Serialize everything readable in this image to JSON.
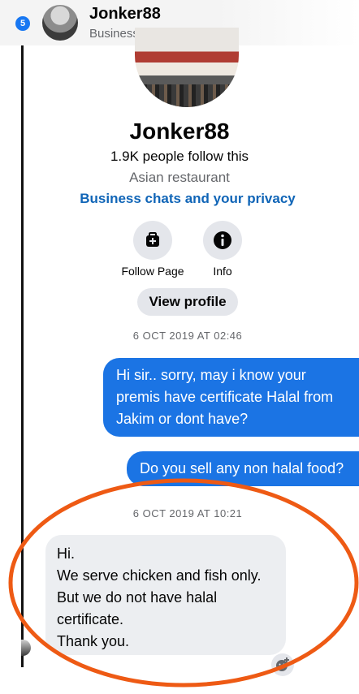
{
  "header": {
    "notif_badge": "5",
    "name": "Jonker88",
    "subtitle": "Business chat"
  },
  "profile": {
    "name": "Jonker88",
    "followers": "1.9K people follow this",
    "category": "Asian restaurant",
    "privacy_link": "Business chats and your privacy"
  },
  "actions": [
    {
      "label": "Follow Page",
      "icon": "follow-page-icon"
    },
    {
      "label": "Info",
      "icon": "info-icon"
    }
  ],
  "view_profile_label": "View profile",
  "conversation": {
    "timestamp_1": "6 OCT 2019 AT 02:46",
    "outgoing_1": [
      "Hi sir.. sorry, may i know your",
      "premis have certificate Halal from",
      "Jakim or dont have?"
    ],
    "outgoing_2": "Do you sell any non halal food?",
    "timestamp_2": "6 OCT 2019 AT 10:21",
    "incoming_1": [
      "Hi.",
      "We serve chicken and fish only.",
      "But we do not have halal",
      "certificate.",
      "Thank you."
    ]
  },
  "colors": {
    "accent_blue": "#1b74e4",
    "link_blue": "#1065b7",
    "annotation_orange": "#ee5a14",
    "bubble_gray": "#eceef1"
  }
}
